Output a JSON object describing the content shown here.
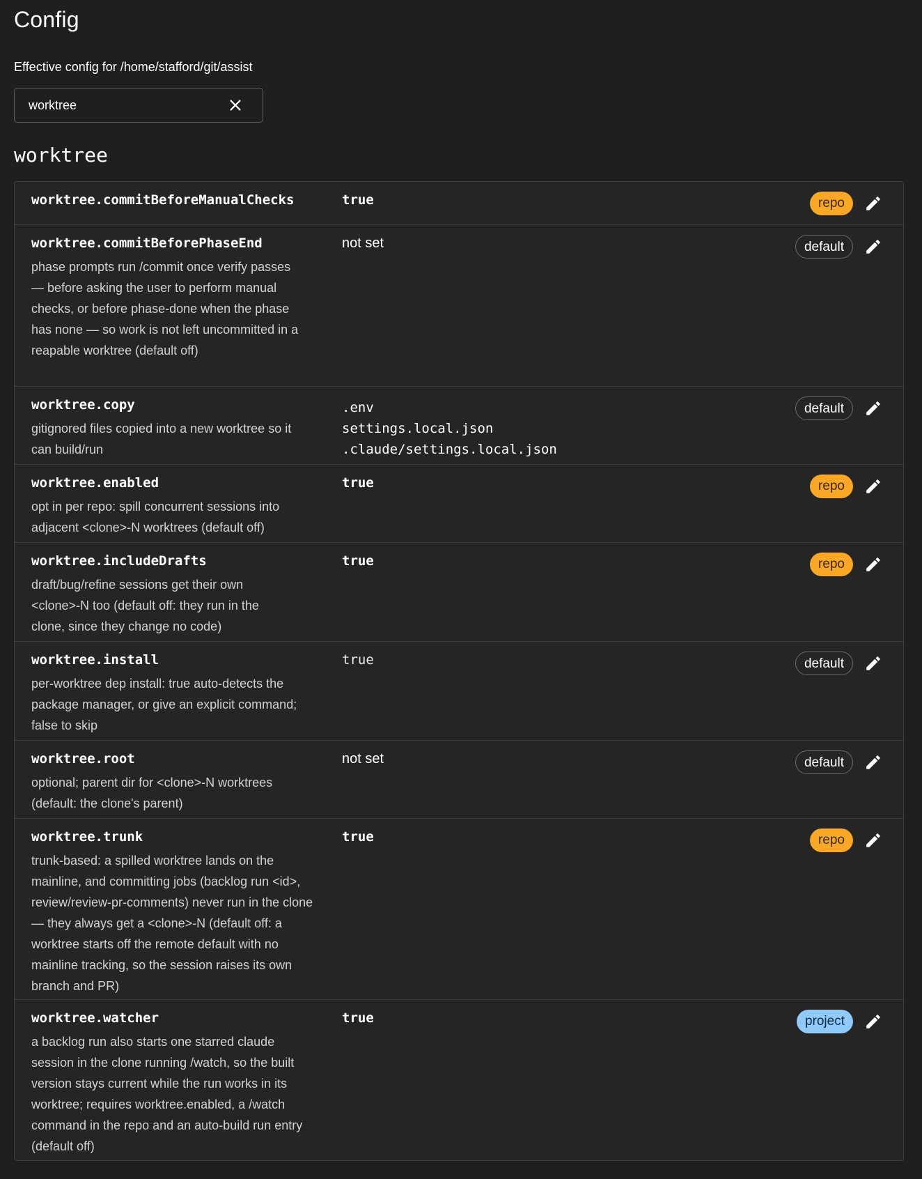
{
  "page": {
    "title": "Config",
    "subtitle": "Effective config for /home/stafford/git/assist"
  },
  "search": {
    "value": "worktree"
  },
  "section": {
    "title": "worktree"
  },
  "colors": {
    "background": "#1f1f1f",
    "repo_badge": "#f9a825",
    "project_badge": "#90caf9",
    "default_badge_border": "#6c6c6c"
  },
  "icons": {
    "clear": "close-icon",
    "edit": "pencil-icon"
  },
  "rows": [
    {
      "key": "worktree.commitBeforeManualChecks",
      "description": "",
      "value": "true",
      "source": "repo"
    },
    {
      "key": "worktree.commitBeforePhaseEnd",
      "description": "phase prompts run /commit once verify passes — before asking the user to perform manual checks, or before phase-done when the phase has none — so work is not left uncommitted in a reapable worktree (default off)",
      "value": "not set",
      "source": "default"
    },
    {
      "key": "worktree.copy",
      "description": "gitignored files copied into a new worktree so it can build/run",
      "values": [
        ".env",
        "settings.local.json",
        ".claude/settings.local.json"
      ],
      "source": "default"
    },
    {
      "key": "worktree.enabled",
      "description": "opt in per repo: spill concurrent sessions into adjacent <clone>-N worktrees (default off)",
      "value": "true",
      "source": "repo"
    },
    {
      "key": "worktree.includeDrafts",
      "description": "draft/bug/refine sessions get their own <clone>-N too (default off: they run in the clone, since they change no code)",
      "value": "true",
      "source": "repo"
    },
    {
      "key": "worktree.install",
      "description": "per-worktree dep install: true auto-detects the package manager, or give an explicit command; false to skip",
      "value": "true",
      "source": "default"
    },
    {
      "key": "worktree.root",
      "description": "optional; parent dir for <clone>-N worktrees (default: the clone's parent)",
      "value": "not set",
      "source": "default"
    },
    {
      "key": "worktree.trunk",
      "description": "trunk-based: a spilled worktree lands on the mainline, and committing jobs (backlog run <id>, review/review-pr-comments) never run in the clone — they always get a <clone>-N (default off: a worktree starts off the remote default with no mainline tracking, so the session raises its own branch and PR)",
      "value": "true",
      "source": "repo"
    },
    {
      "key": "worktree.watcher",
      "description": "a backlog run also starts one starred claude session in the clone running /watch, so the built version stays current while the run works in its worktree; requires worktree.enabled, a /watch command in the repo and an auto-build run entry (default off)",
      "value": "true",
      "source": "project"
    }
  ]
}
